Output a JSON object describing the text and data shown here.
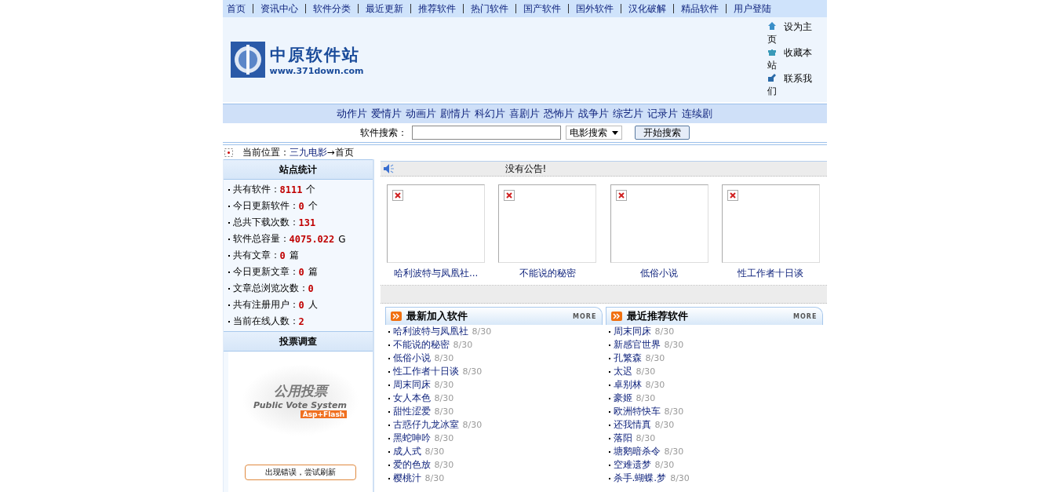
{
  "top_nav": [
    "首页",
    "资讯中心",
    "软件分类",
    "最近更新",
    "推荐软件",
    "热门软件",
    "国产软件",
    "国外软件",
    "汉化破解",
    "精品软件",
    "用户登陆"
  ],
  "logo": {
    "title": "中原软件站",
    "url": "www.371down.com"
  },
  "quick_links": [
    {
      "kind": "home",
      "label": "设为主页"
    },
    {
      "kind": "gift",
      "label": "收藏本站"
    },
    {
      "kind": "edit",
      "label": "联系我们"
    }
  ],
  "genres": [
    "动作片",
    "爱情片",
    "动画片",
    "剧情片",
    "科幻片",
    "喜剧片",
    "恐怖片",
    "战争片",
    "综艺片",
    "记录片",
    "连续剧"
  ],
  "search": {
    "label": "软件搜索：",
    "select": "电影搜索",
    "button": "开始搜索"
  },
  "location": {
    "label": "当前位置：",
    "link": "三九电影",
    "arrow": "→",
    "current": "首页"
  },
  "stats": {
    "title": "站点统计",
    "items": [
      {
        "label": "共有软件：",
        "value": "8111",
        "unit": "个"
      },
      {
        "label": "今日更新软件：",
        "value": "0",
        "unit": "个"
      },
      {
        "label": "总共下载次数：",
        "value": "131"
      },
      {
        "label": "软件总容量：",
        "value": "4075.022",
        "unit": "G"
      },
      {
        "label": "共有文章：",
        "value": "0",
        "unit": "篇"
      },
      {
        "label": "今日更新文章：",
        "value": "0",
        "unit": "篇"
      },
      {
        "label": "文章总浏览次数：",
        "value": "0"
      },
      {
        "label": "共有注册用户：",
        "value": "0",
        "unit": "人"
      },
      {
        "label": "当前在线人数：",
        "value": "2"
      }
    ]
  },
  "vote": {
    "title": "投票调查",
    "banner_title": "公用投票",
    "banner_subtitle": "Public Vote System",
    "banner_tag": "Asp+Flash",
    "button": "出现错误，尝试刷新"
  },
  "notice": "没有公告!",
  "featured": [
    "哈利波特与凤凰社...",
    "不能说的秘密",
    "低俗小说",
    "性工作者十日谈"
  ],
  "lists": [
    {
      "title": "最新加入软件",
      "more": "MORE",
      "items": [
        {
          "name": "哈利波特与凤凰社",
          "date": "8/30"
        },
        {
          "name": "不能说的秘密",
          "date": "8/30"
        },
        {
          "name": "低俗小说",
          "date": "8/30"
        },
        {
          "name": "性工作者十日谈",
          "date": "8/30"
        },
        {
          "name": "周末同床",
          "date": "8/30"
        },
        {
          "name": "女人本色",
          "date": "8/30"
        },
        {
          "name": "甜性涩爱",
          "date": "8/30"
        },
        {
          "name": "古惑仔九龙冰室",
          "date": "8/30"
        },
        {
          "name": "黑蛇呻吟",
          "date": "8/30"
        },
        {
          "name": "成人式",
          "date": "8/30"
        },
        {
          "name": "爱的色放",
          "date": "8/30"
        },
        {
          "name": "樱桃汁",
          "date": "8/30"
        }
      ]
    },
    {
      "title": "最近推荐软件",
      "more": "MORE",
      "items": [
        {
          "name": "周末同床",
          "date": "8/30"
        },
        {
          "name": "新感官世界",
          "date": "8/30"
        },
        {
          "name": "孔繁森",
          "date": "8/30"
        },
        {
          "name": "太迟",
          "date": "8/30"
        },
        {
          "name": "卓别林",
          "date": "8/30"
        },
        {
          "name": "豪姬",
          "date": "8/30"
        },
        {
          "name": "欧洲特快车",
          "date": "8/30"
        },
        {
          "name": "还我情真",
          "date": "8/30"
        },
        {
          "name": "落阳",
          "date": "8/30"
        },
        {
          "name": "塘鹅暗杀令",
          "date": "8/30"
        },
        {
          "name": "空难遗梦",
          "date": "8/30"
        },
        {
          "name": "杀手.蝴蝶.梦",
          "date": "8/30"
        }
      ]
    }
  ]
}
